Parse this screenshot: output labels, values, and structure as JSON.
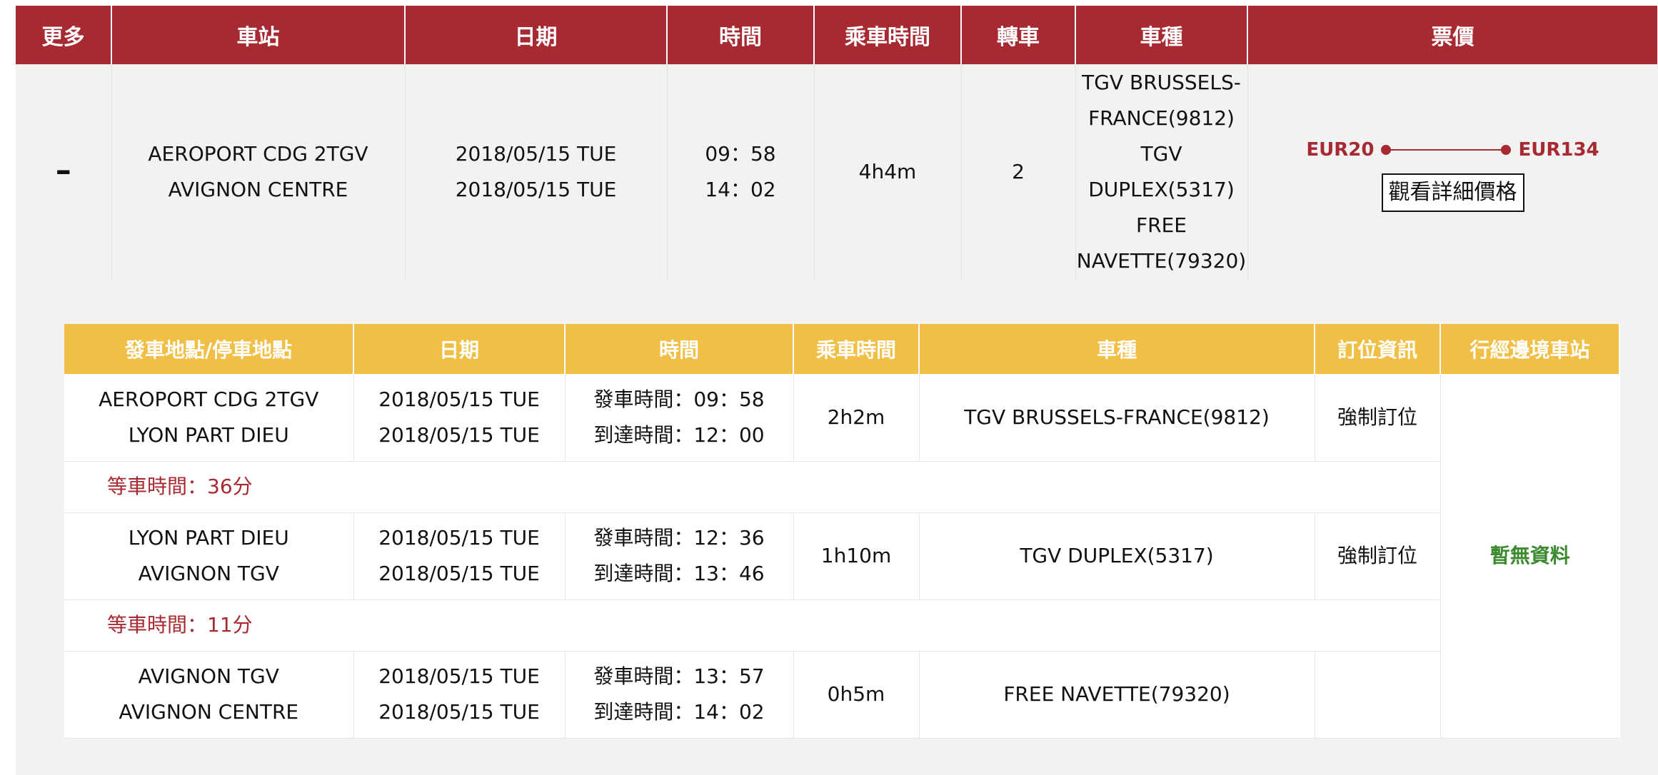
{
  "main_table": {
    "headers": [
      "更多",
      "車站",
      "日期",
      "時間",
      "乘車時間",
      "轉車",
      "車種",
      "票價"
    ],
    "row": {
      "collapse": "–",
      "stations": [
        "AEROPORT CDG 2TGV",
        "AVIGNON CENTRE"
      ],
      "dates": [
        "2018/05/15 TUE",
        "2018/05/15 TUE"
      ],
      "times": [
        "09：58",
        "14：02"
      ],
      "duration": "4h4m",
      "transfers": "2",
      "trains": [
        "TGV BRUSSELS-",
        "FRANCE(9812)",
        "TGV",
        "DUPLEX(5317)",
        "FREE",
        "NAVETTE(79320)"
      ],
      "price_min": "EUR20",
      "price_max": "EUR134",
      "price_button": "觀看詳細價格"
    }
  },
  "detail_table": {
    "headers": [
      "發車地點/停車地點",
      "日期",
      "時間",
      "乘車時間",
      "車種",
      "訂位資訊",
      "行經邊境車站"
    ],
    "segments": [
      {
        "from": "AEROPORT CDG 2TGV",
        "to": "LYON PART DIEU",
        "date1": "2018/05/15 TUE",
        "date2": "2018/05/15 TUE",
        "depart": "發車時間：09：58",
        "arrive": "到達時間：12：00",
        "duration": "2h2m",
        "train": "TGV BRUSSELS-FRANCE(9812)",
        "booking": "強制訂位"
      },
      {
        "from": "LYON PART DIEU",
        "to": "AVIGNON TGV",
        "date1": "2018/05/15 TUE",
        "date2": "2018/05/15 TUE",
        "depart": "發車時間：12：36",
        "arrive": "到達時間：13：46",
        "duration": "1h10m",
        "train": "TGV DUPLEX(5317)",
        "booking": "強制訂位"
      },
      {
        "from": "AVIGNON TGV",
        "to": "AVIGNON CENTRE",
        "date1": "2018/05/15 TUE",
        "date2": "2018/05/15 TUE",
        "depart": "發車時間：13：57",
        "arrive": "到達時間：14：02",
        "duration": "0h5m",
        "train": "FREE NAVETTE(79320)",
        "booking": ""
      }
    ],
    "waits": [
      "等車時間：36分",
      "等車時間：11分"
    ],
    "border_station": "暫無資料"
  },
  "colors": {
    "header_red": "#a72932",
    "header_yellow": "#f1bf45",
    "wait_red": "#a72932",
    "nodata_green": "#3c8a2e"
  }
}
